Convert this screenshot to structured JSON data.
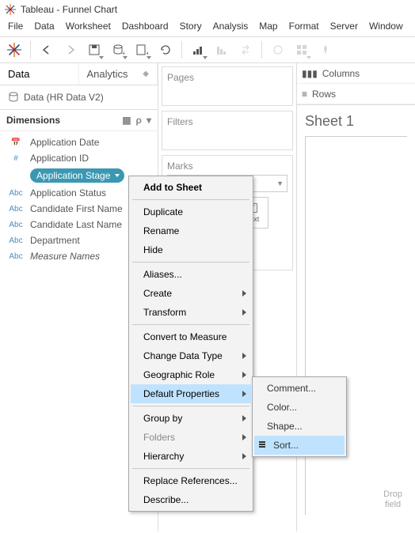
{
  "window": {
    "title": "Tableau - Funnel Chart"
  },
  "menubar": [
    "File",
    "Data",
    "Worksheet",
    "Dashboard",
    "Story",
    "Analysis",
    "Map",
    "Format",
    "Server",
    "Window"
  ],
  "left": {
    "tabs": {
      "data": "Data",
      "analytics": "Analytics"
    },
    "datasource": "Data (HR Data V2)",
    "dimensionsLabel": "Dimensions",
    "fields": [
      {
        "type": "date",
        "name": "Application Date"
      },
      {
        "type": "num",
        "name": "Application ID"
      },
      {
        "type": "abc",
        "name": "Application Stage",
        "selected": true
      },
      {
        "type": "abc",
        "name": "Application Status"
      },
      {
        "type": "abc",
        "name": "Candidate First Name"
      },
      {
        "type": "abc",
        "name": "Candidate Last Name"
      },
      {
        "type": "abc",
        "name": "Department"
      },
      {
        "type": "abc",
        "name": "Measure Names",
        "italic": true
      }
    ]
  },
  "mid": {
    "pages": "Pages",
    "filters": "Filters",
    "marks": "Marks",
    "textLabel": "Text"
  },
  "right": {
    "columns": "Columns",
    "rows": "Rows",
    "sheetTitle": "Sheet 1",
    "dropHint": "Drop\nfield"
  },
  "ctx": {
    "addToSheet": "Add to Sheet",
    "duplicate": "Duplicate",
    "rename": "Rename",
    "hide": "Hide",
    "aliases": "Aliases...",
    "create": "Create",
    "transform": "Transform",
    "convert": "Convert to Measure",
    "changeType": "Change Data Type",
    "geoRole": "Geographic Role",
    "defaultProps": "Default Properties",
    "groupBy": "Group by",
    "folders": "Folders",
    "hierarchy": "Hierarchy",
    "replaceRefs": "Replace References...",
    "describe": "Describe..."
  },
  "ctx_sub": {
    "comment": "Comment...",
    "color": "Color...",
    "shape": "Shape...",
    "sort": "Sort..."
  }
}
